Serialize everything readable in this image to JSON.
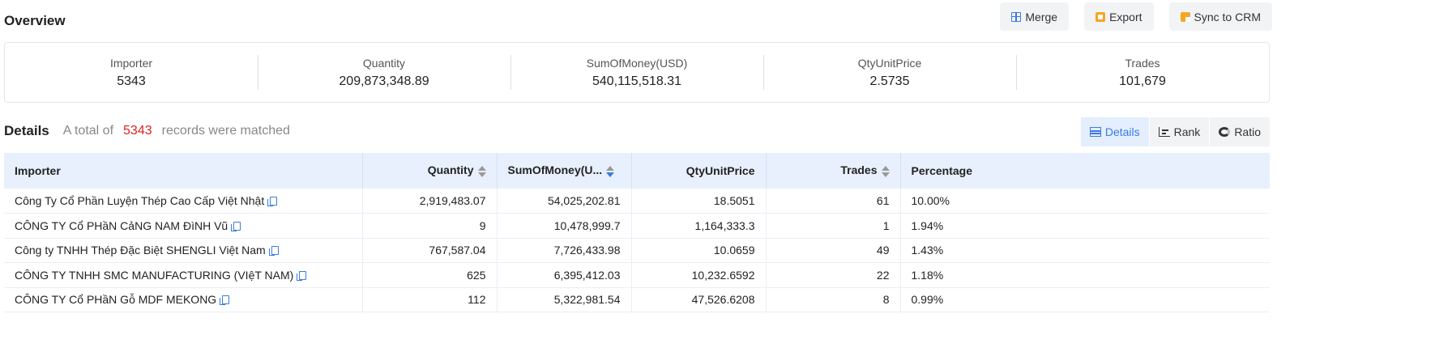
{
  "overview": {
    "title": "Overview",
    "actions": {
      "merge": "Merge",
      "export": "Export",
      "sync": "Sync to CRM"
    }
  },
  "stats": [
    {
      "label": "Importer",
      "value": "5343"
    },
    {
      "label": "Quantity",
      "value": "209,873,348.89"
    },
    {
      "label": "SumOfMoney(USD)",
      "value": "540,115,518.31"
    },
    {
      "label": "QtyUnitPrice",
      "value": "2.5735"
    },
    {
      "label": "Trades",
      "value": "101,679"
    }
  ],
  "details": {
    "title": "Details",
    "prefix": "A total of",
    "count": "5343",
    "suffix": "records were matched",
    "views": {
      "details": "Details",
      "rank": "Rank",
      "ratio": "Ratio"
    }
  },
  "table": {
    "headers": {
      "importer": "Importer",
      "quantity": "Quantity",
      "sum": "SumOfMoney(U...",
      "unit": "QtyUnitPrice",
      "trades": "Trades",
      "percentage": "Percentage"
    },
    "rows": [
      {
        "importer": "Công Ty Cổ Phần Luyện Thép Cao Cấp Việt Nhật",
        "quantity": "2,919,483.07",
        "sum": "54,025,202.81",
        "unit": "18.5051",
        "trades": "61",
        "percentage": "10.00%"
      },
      {
        "importer": "CÔNG TY Cổ PHầN CảNG NAM ĐìNH Vũ",
        "quantity": "9",
        "sum": "10,478,999.7",
        "unit": "1,164,333.3",
        "trades": "1",
        "percentage": "1.94%"
      },
      {
        "importer": "Công ty TNHH Thép Đặc Biệt SHENGLI Việt Nam",
        "quantity": "767,587.04",
        "sum": "7,726,433.98",
        "unit": "10.0659",
        "trades": "49",
        "percentage": "1.43%"
      },
      {
        "importer": "CÔNG TY TNHH SMC MANUFACTURING (VIệT NAM)",
        "quantity": "625",
        "sum": "6,395,412.03",
        "unit": "10,232.6592",
        "trades": "22",
        "percentage": "1.18%"
      },
      {
        "importer": "CÔNG TY Cổ PHầN Gỗ MDF MEKONG",
        "quantity": "112",
        "sum": "5,322,981.54",
        "unit": "47,526.6208",
        "trades": "8",
        "percentage": "0.99%"
      }
    ]
  }
}
